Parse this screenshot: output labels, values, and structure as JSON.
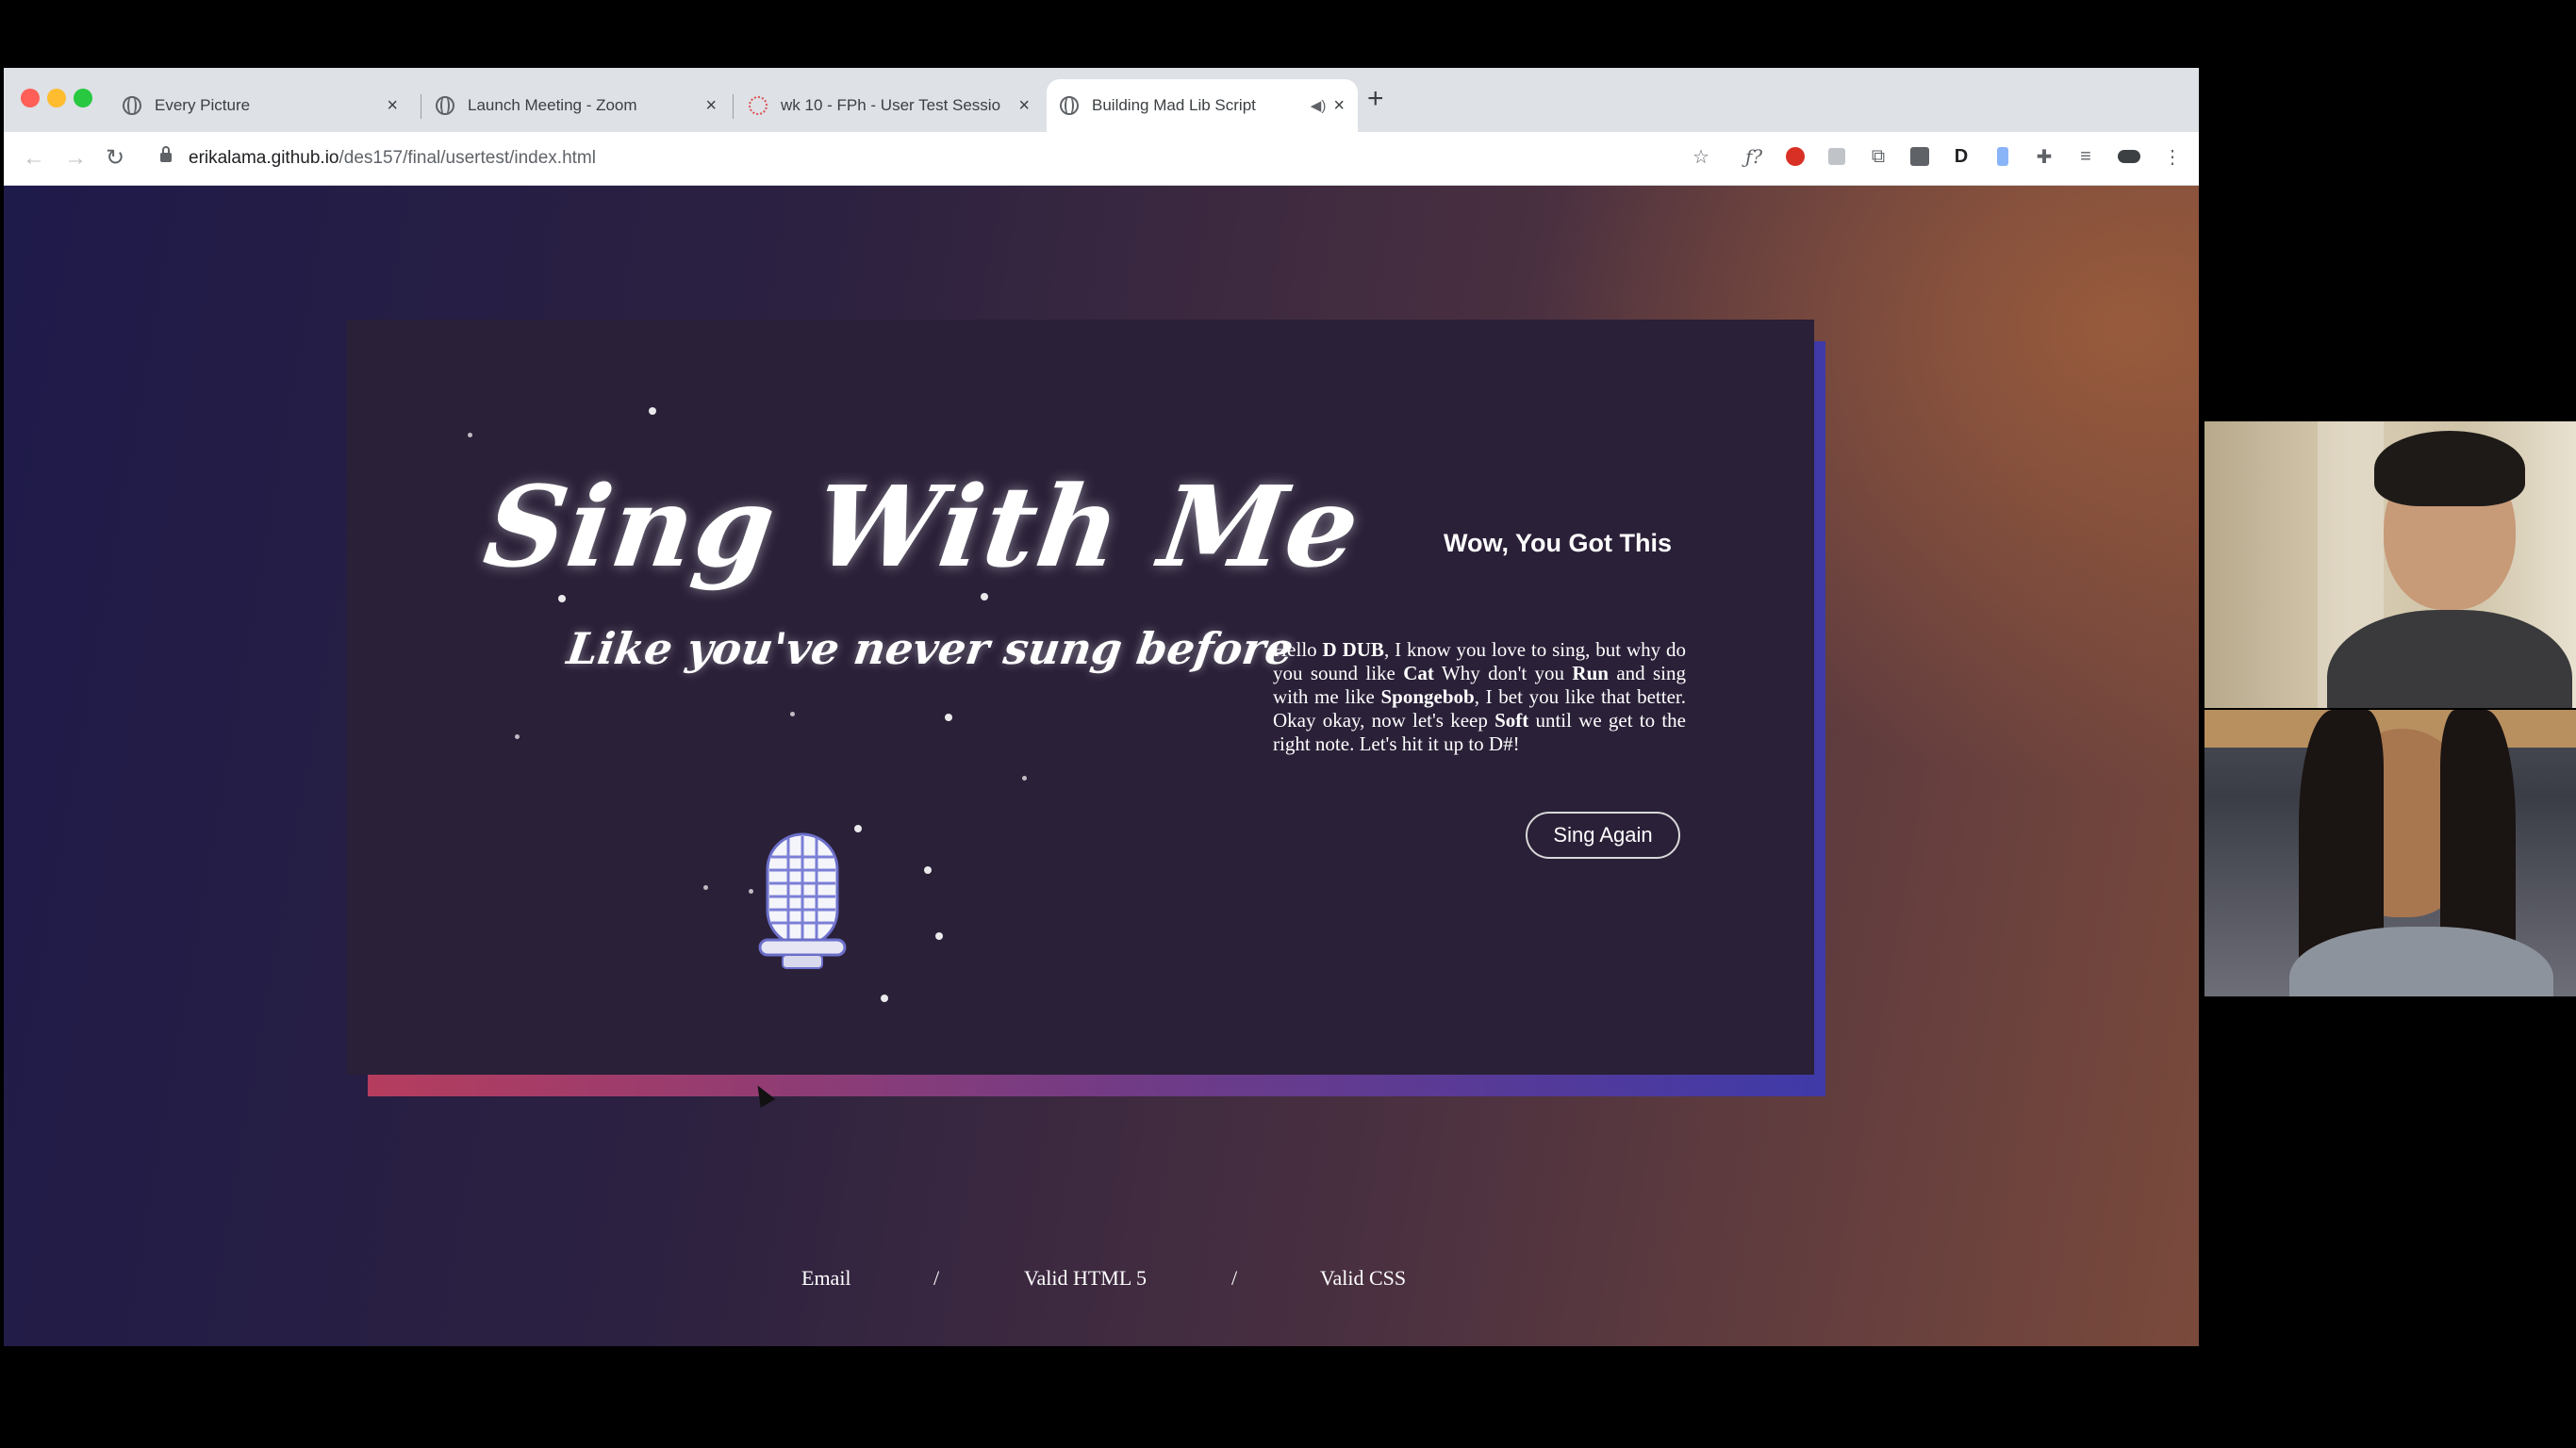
{
  "browser": {
    "tabs": [
      {
        "label": "Every Picture",
        "active": false
      },
      {
        "label": "Launch Meeting - Zoom",
        "active": false
      },
      {
        "label": "wk 10 - FPh - User Test Sessio",
        "active": false
      },
      {
        "label": "Building Mad Lib Script",
        "active": true
      }
    ],
    "url_host": "erikalama.github.io",
    "url_path": "/des157/final/usertest/index.html"
  },
  "page": {
    "title": "Sing With Me",
    "subtitle": "Like you've never sung before",
    "result_title": "Wow, You Got This",
    "story": {
      "p1": "Hello ",
      "name": "D DUB",
      "p2": ", I know you love to sing, but why do you sound like ",
      "animal": "Cat",
      "p3": " Why don't you ",
      "verb": "Run",
      "p4": " and sing with me like ",
      "character": "Spongebob",
      "p5": ", I bet you like that better. Okay okay, now let's keep ",
      "adjective": "Soft",
      "p6": " until we get to the right note. Let's hit it up to D#!"
    },
    "button_label": "Sing Again",
    "footer": {
      "email": "Email",
      "sep1": "/",
      "html": "Valid HTML 5",
      "sep2": "/",
      "css": "Valid CSS"
    }
  },
  "colors": {
    "card_bg": "#2a2038",
    "card_shadow_start": "#b53d5e",
    "card_shadow_end": "#3f3aa8"
  }
}
